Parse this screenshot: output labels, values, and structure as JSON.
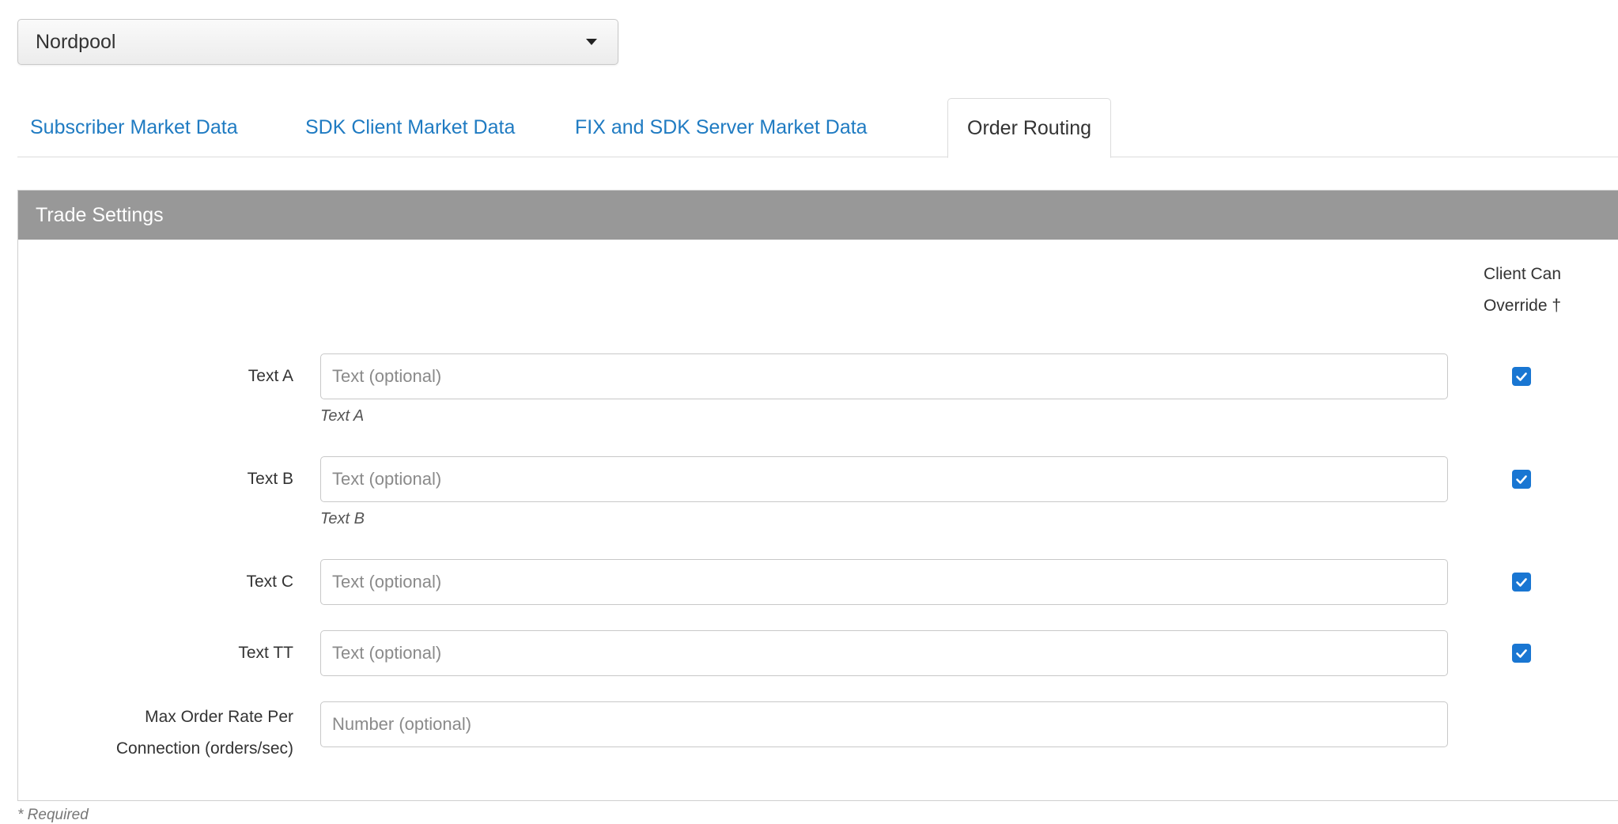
{
  "exchange_select": {
    "value": "Nordpool"
  },
  "tabs": [
    {
      "label": "Subscriber Market Data",
      "active": false
    },
    {
      "label": "SDK Client Market Data",
      "active": false
    },
    {
      "label": "FIX and SDK Server Market Data",
      "active": false
    },
    {
      "label": "Order Routing",
      "active": true
    }
  ],
  "panel": {
    "title": "Trade Settings",
    "override_header_line1": "Client Can",
    "override_header_line2": "Override †",
    "fields": [
      {
        "label": "Text A",
        "placeholder": "Text (optional)",
        "value": "",
        "help": "Text A",
        "client_can_override": true
      },
      {
        "label": "Text B",
        "placeholder": "Text (optional)",
        "value": "",
        "help": "Text B",
        "client_can_override": true
      },
      {
        "label": "Text C",
        "placeholder": "Text (optional)",
        "value": "",
        "client_can_override": true
      },
      {
        "label": "Text TT",
        "placeholder": "Text (optional)",
        "value": "",
        "client_can_override": true
      },
      {
        "label_line1": "Max Order Rate Per",
        "label_line2": "Connection (orders/sec)",
        "placeholder": "Number (optional)",
        "value": ""
      }
    ]
  },
  "footer": {
    "required_note": "* Required"
  },
  "colors": {
    "accent": "#1976d2",
    "tab_link": "#1f7bc2",
    "panel_header": "#989898"
  }
}
